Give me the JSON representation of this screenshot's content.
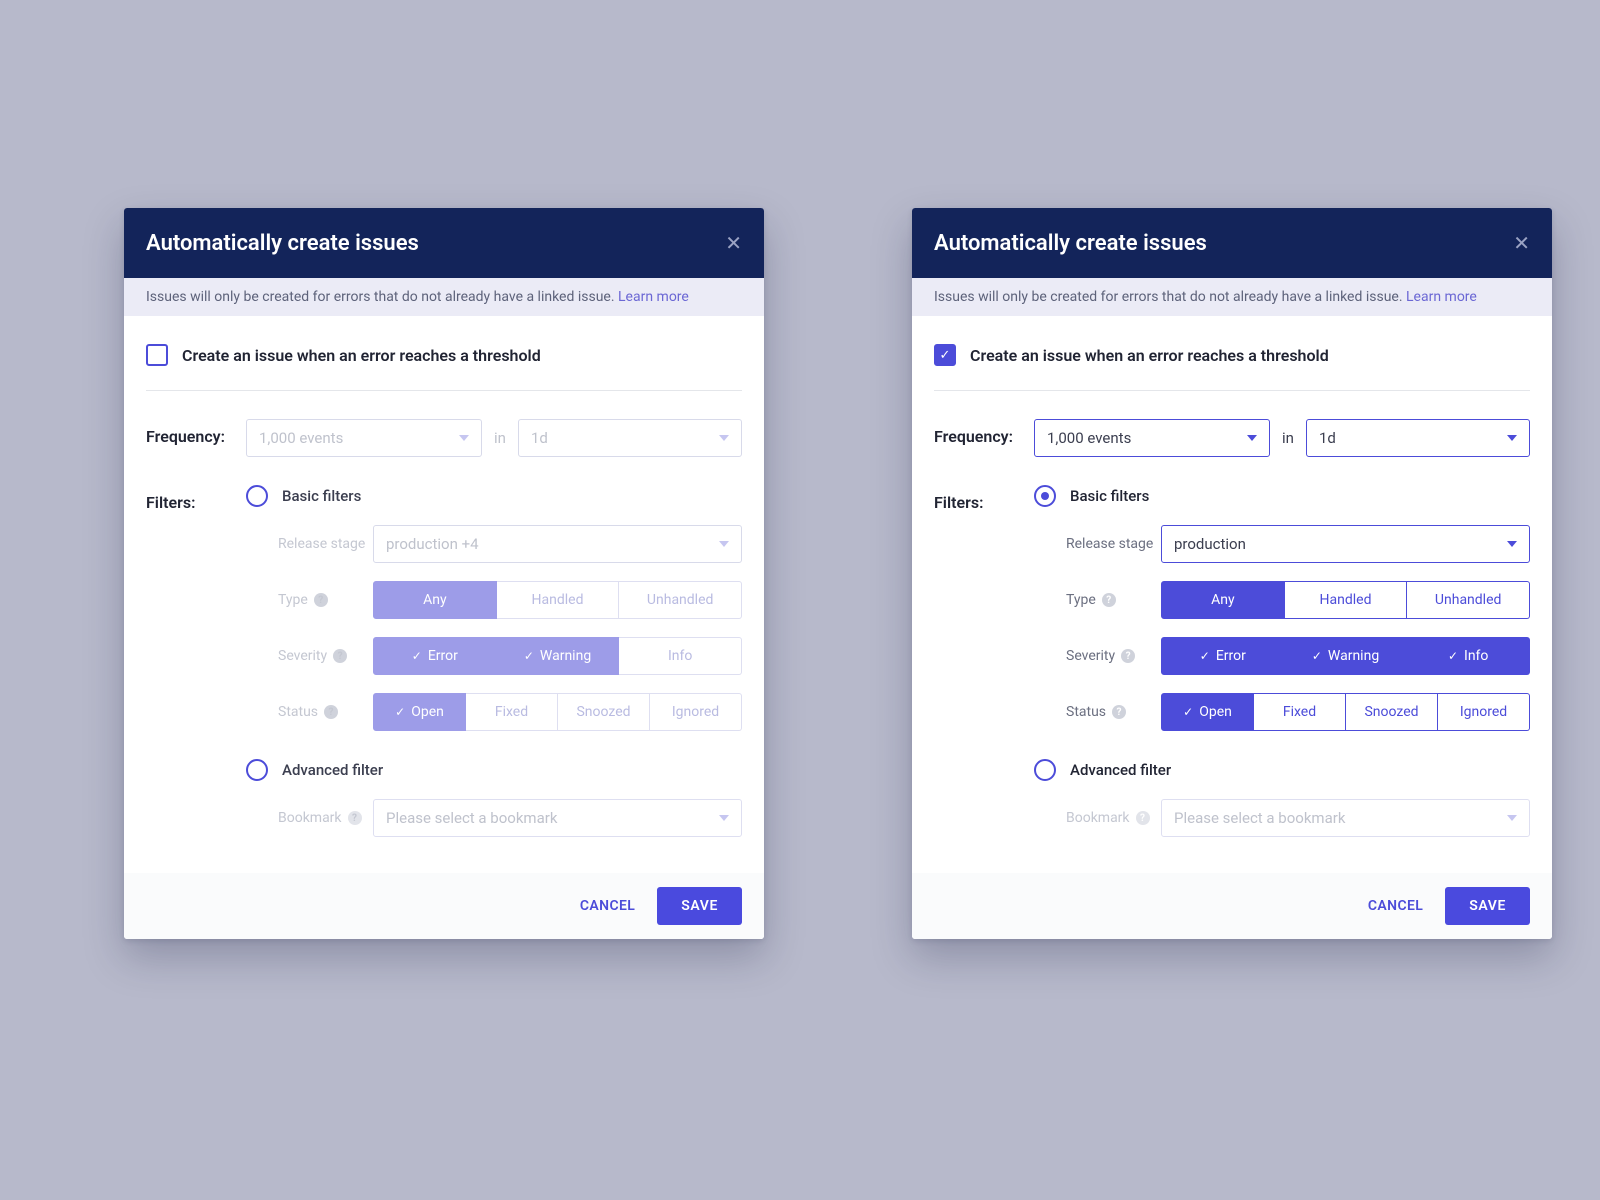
{
  "dialog": {
    "title": "Automatically create issues",
    "info_text": "Issues will only be created for errors that do not already have a linked issue. ",
    "learn_more": "Learn more",
    "checkbox_label": "Create an issue when an error reaches a threshold",
    "frequency_label": "Frequency:",
    "frequency_value": "1,000 events",
    "frequency_joiner": "in",
    "frequency_period": "1d",
    "filters_label": "Filters:",
    "radio_basic": "Basic filters",
    "radio_advanced": "Advanced filter",
    "release_stage_label": "Release stage",
    "release_stage_value_a": "production +4",
    "release_stage_value_b": "production",
    "type_label": "Type",
    "type_any": "Any",
    "type_handled": "Handled",
    "type_unhandled": "Unhandled",
    "severity_label": "Severity",
    "severity_error": "Error",
    "severity_warning": "Warning",
    "severity_info": "Info",
    "status_label": "Status",
    "status_open": "Open",
    "status_fixed": "Fixed",
    "status_snoozed": "Snoozed",
    "status_ignored": "Ignored",
    "bookmark_label": "Bookmark",
    "bookmark_placeholder": "Please select a bookmark",
    "cancel": "CANCEL",
    "save": "SAVE"
  }
}
